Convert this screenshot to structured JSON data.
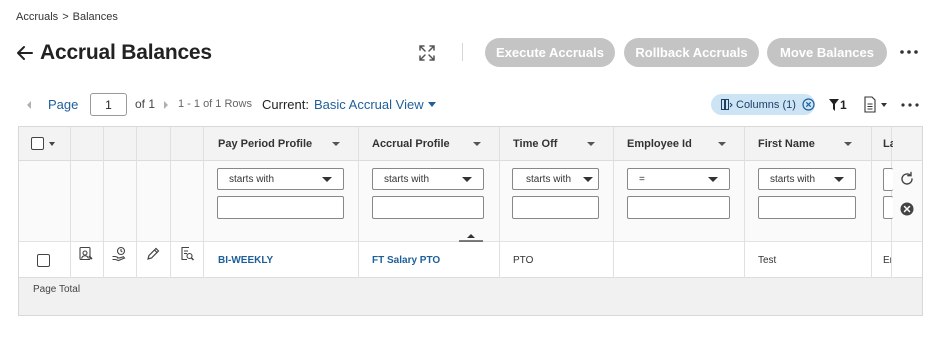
{
  "breadcrumb": {
    "parent": "Accruals",
    "separator": ">",
    "current": "Balances"
  },
  "page": {
    "title": "Accrual Balances"
  },
  "actions": {
    "execute": "Execute Accruals",
    "rollback": "Rollback Accruals",
    "move": "Move Balances"
  },
  "pagination": {
    "page_label": "Page",
    "page_value": "1",
    "of_text": "of 1",
    "rows_text": "1 - 1 of 1 Rows"
  },
  "view": {
    "current_label": "Current:",
    "current_value": "Basic Accrual View"
  },
  "toolbar": {
    "columns_chip": "Columns (1)",
    "filter_count": "1"
  },
  "grid": {
    "columns": [
      {
        "label": "Pay Period Profile"
      },
      {
        "label": "Accrual Profile"
      },
      {
        "label": "Time Off"
      },
      {
        "label": "Employee Id"
      },
      {
        "label": "First Name"
      },
      {
        "label": "La"
      }
    ],
    "filters": [
      {
        "operator": "starts with"
      },
      {
        "operator": "starts with"
      },
      {
        "operator": "starts with"
      },
      {
        "operator": "="
      },
      {
        "operator": "starts with"
      }
    ],
    "rows": [
      {
        "pay_period_profile": "BI-WEEKLY",
        "accrual_profile": "FT Salary PTO",
        "time_off": "PTO",
        "employee_id": "",
        "first_name": "Test",
        "last_name": "Er"
      }
    ],
    "total_label": "Page Total"
  },
  "colors": {
    "link": "#1f5f99",
    "disabled_button": "#c4c4c4",
    "chip_bg": "#cde4f5"
  }
}
